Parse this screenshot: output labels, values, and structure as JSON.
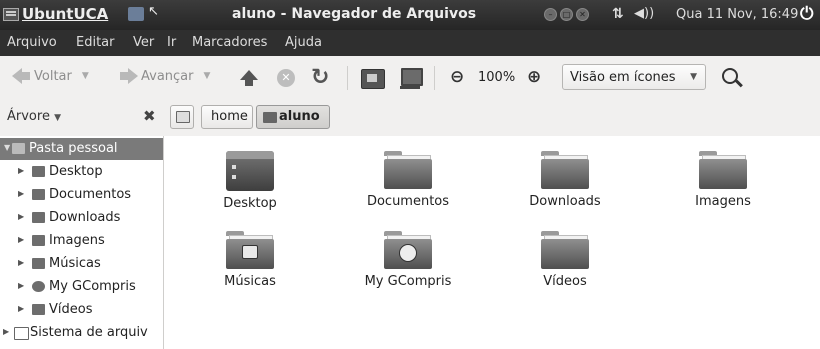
{
  "top_panel": {
    "brand": "UbuntUCA",
    "window_title": "aluno - Navegador de Arquivos",
    "clock": "Qua 11 Nov, 16:49"
  },
  "menu": [
    "Arquivo",
    "Editar",
    "Ver",
    "Ir",
    "Marcadores",
    "Ajuda"
  ],
  "toolbar": {
    "back_label": "Voltar",
    "forward_label": "Avançar",
    "zoom": "100%",
    "view_mode": "Visão em ícones"
  },
  "location": {
    "tree_label": "Árvore",
    "crumbs": [
      "home",
      "aluno"
    ]
  },
  "sidebar": {
    "items": [
      {
        "label": "Pasta pessoal",
        "selected": true,
        "icon": "home-folder-icon"
      },
      {
        "label": "Desktop",
        "icon": "desktop-icon"
      },
      {
        "label": "Documentos",
        "icon": "folder-icon"
      },
      {
        "label": "Downloads",
        "icon": "folder-icon"
      },
      {
        "label": "Imagens",
        "icon": "folder-icon"
      },
      {
        "label": "Músicas",
        "icon": "music-folder-icon"
      },
      {
        "label": "My GCompris",
        "icon": "gcompris-icon"
      },
      {
        "label": "Vídeos",
        "icon": "folder-icon"
      },
      {
        "label": "Sistema de arquiv",
        "icon": "drive-icon"
      }
    ]
  },
  "files": [
    {
      "name": "Desktop",
      "icon": "desktop-folder-icon"
    },
    {
      "name": "Documentos",
      "icon": "folder-icon"
    },
    {
      "name": "Downloads",
      "icon": "folder-icon"
    },
    {
      "name": "Imagens",
      "icon": "folder-icon"
    },
    {
      "name": "Músicas",
      "icon": "music-folder-icon"
    },
    {
      "name": "My GCompris",
      "icon": "gcompris-folder-icon"
    },
    {
      "name": "Vídeos",
      "icon": "folder-icon"
    }
  ]
}
